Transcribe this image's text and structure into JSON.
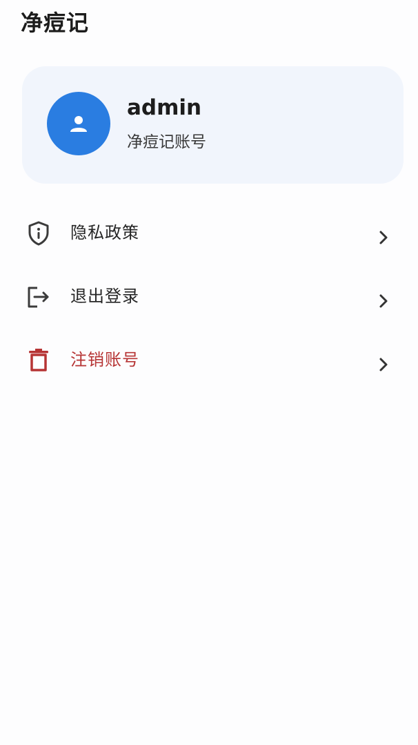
{
  "header": {
    "title": "净痘记"
  },
  "profile": {
    "username": "admin",
    "subtitle": "净痘记账号",
    "avatar_icon": "user-icon",
    "avatar_color": "#2a7de1"
  },
  "menu": {
    "items": [
      {
        "label": "隐私政策",
        "icon": "shield-info-icon"
      },
      {
        "label": "退出登录",
        "icon": "logout-icon"
      },
      {
        "label": "注销账号",
        "icon": "trash-icon",
        "color": "#b63434"
      }
    ]
  }
}
